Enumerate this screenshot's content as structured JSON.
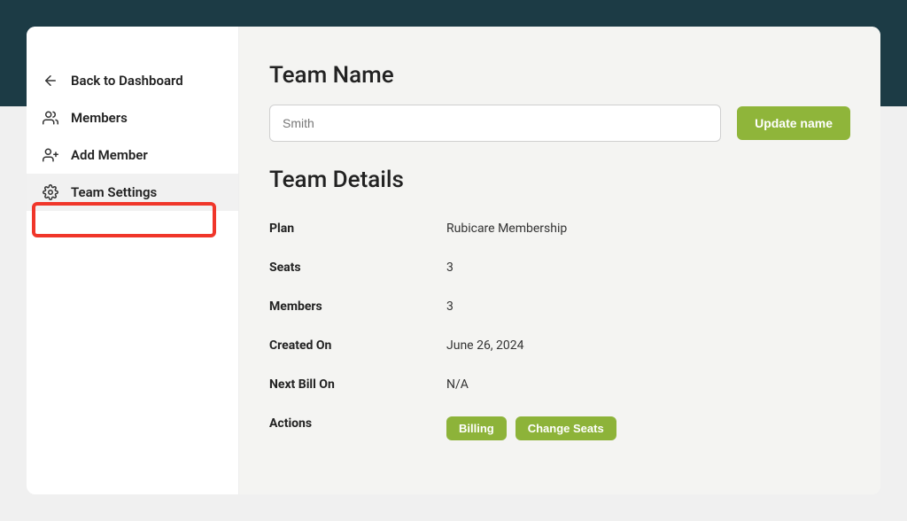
{
  "sidebar": {
    "back": "Back to Dashboard",
    "members": "Members",
    "add_member": "Add Member",
    "team_settings": "Team Settings"
  },
  "main": {
    "team_name_heading": "Team Name",
    "team_name_value": "Smith",
    "update_name_btn": "Update name",
    "details_heading": "Team Details",
    "rows": {
      "plan_label": "Plan",
      "plan_value": "Rubicare Membership",
      "seats_label": "Seats",
      "seats_value": "3",
      "members_label": "Members",
      "members_value": "3",
      "created_label": "Created On",
      "created_value": "June 26, 2024",
      "next_bill_label": "Next Bill On",
      "next_bill_value": "N/A",
      "actions_label": "Actions",
      "billing_btn": "Billing",
      "change_seats_btn": "Change Seats"
    }
  }
}
